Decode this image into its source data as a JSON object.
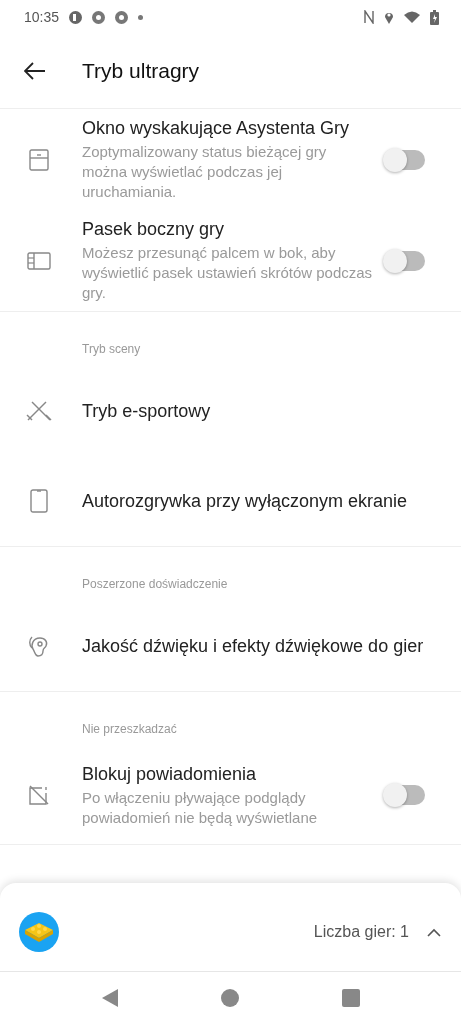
{
  "status_bar": {
    "time": "10:35"
  },
  "header": {
    "title": "Tryb ultragry"
  },
  "sections": [
    {
      "items": [
        {
          "kind": "toggle",
          "title": "Okno wyskakujące Asystenta Gry",
          "description": "Zoptymalizowany status bieżącej gry można wyświetlać podczas jej uruchamiania.",
          "on": false
        },
        {
          "kind": "toggle",
          "title": "Pasek boczny gry",
          "description": "Możesz przesunąć palcem w bok, aby wyświetlić pasek ustawień skrótów podczas gry.",
          "on": false
        }
      ]
    },
    {
      "label": "Tryb sceny",
      "items": [
        {
          "kind": "link",
          "title": "Tryb e-sportowy"
        },
        {
          "kind": "link",
          "title": "Autorozgrywka przy wyłączonym ekranie"
        }
      ]
    },
    {
      "label": "Poszerzone doświadczenie",
      "items": [
        {
          "kind": "link",
          "title": "Jakość dźwięku i efekty dźwiękowe do gier"
        }
      ]
    },
    {
      "label": "Nie przeszkadzać",
      "items": [
        {
          "kind": "toggle",
          "title": "Blokuj powiadomienia",
          "description": "Po włączeniu pływające podglądy powiadomień nie będą wyświetlane",
          "on": false
        }
      ]
    }
  ],
  "bottom_sheet": {
    "count": "Liczba gier: 1"
  }
}
